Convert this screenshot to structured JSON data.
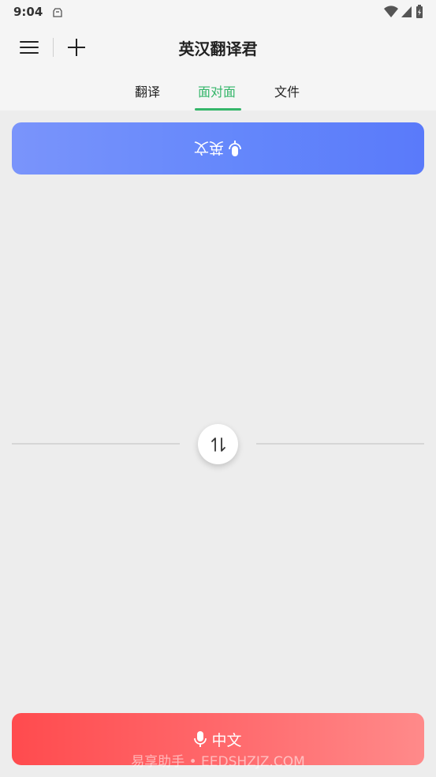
{
  "status_bar": {
    "time": "9:04"
  },
  "app_bar": {
    "title": "英汉翻译君"
  },
  "tabs": [
    {
      "label": "翻译"
    },
    {
      "label": "面对面",
      "active": true
    },
    {
      "label": "文件"
    }
  ],
  "top_speaker": {
    "language_label": "英文"
  },
  "bottom_speaker": {
    "language_label": "中文"
  },
  "watermark": "易享助手 • EEDSHZJZ.COM",
  "colors": {
    "accent_green": "#35b66a",
    "top_button_blue": "#6487fb",
    "bottom_button_red": "#ff5a5d"
  },
  "icons": {
    "menu": "hamburger-icon",
    "add": "plus-icon",
    "mic": "microphone-icon",
    "swap": "swap-icon"
  }
}
